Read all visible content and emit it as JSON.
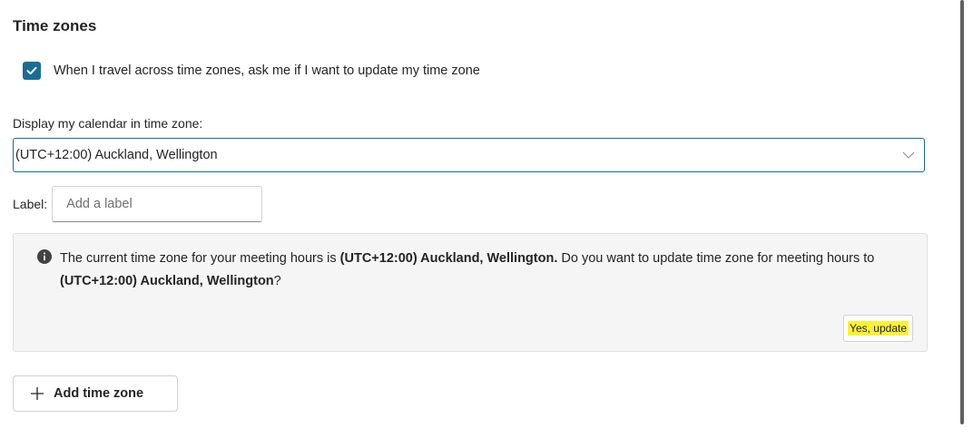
{
  "section": {
    "title": "Time zones"
  },
  "travel_prompt": {
    "checked": true,
    "label": "When I travel across time zones, ask me if I want to update my time zone"
  },
  "display_timezone": {
    "label": "Display my calendar in time zone:",
    "selected": "(UTC+12:00) Auckland, Wellington"
  },
  "tz_label": {
    "label": "Label:",
    "placeholder": "Add a label",
    "value": ""
  },
  "notice": {
    "text_1": "The current time zone for your meeting hours is ",
    "bold_1": "(UTC+12:00) Auckland, Wellington.",
    "text_2": " Do you want to update time zone for meeting hours to ",
    "bold_2": "(UTC+12:00) Auckland, Wellington",
    "text_3": "?",
    "button_label": "Yes, update"
  },
  "add_timezone": {
    "label": "Add time zone"
  },
  "colors": {
    "accent": "#1b6c93",
    "highlight": "#fbf03c"
  }
}
